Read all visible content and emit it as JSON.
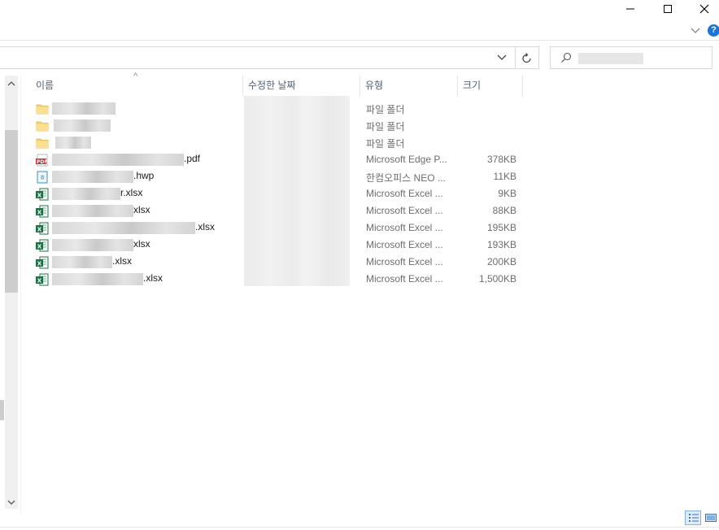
{
  "window": {
    "minimize_icon": "minimize-icon",
    "maximize_icon": "maximize-icon",
    "close_icon": "close-icon"
  },
  "ribbon": {
    "expand_icon": "chevron-down-icon",
    "help_icon": "help-icon",
    "help_label": "?"
  },
  "address": {
    "dropdown_icon": "chevron-down-icon",
    "refresh_icon": "refresh-icon"
  },
  "search": {
    "icon": "search-icon"
  },
  "columns": {
    "name": "이름",
    "date": "수정한 날짜",
    "type": "유형",
    "size": "크기",
    "sort_indicator": "^"
  },
  "files": [
    {
      "icon": "folder-icon",
      "ext": "",
      "type": "파일 폴더",
      "size": ""
    },
    {
      "icon": "folder-icon",
      "ext": "",
      "type": "파일 폴더",
      "size": ""
    },
    {
      "icon": "folder-icon",
      "ext": "",
      "type": "파일 폴더",
      "size": ""
    },
    {
      "icon": "pdf-icon",
      "ext": ".pdf",
      "type": "Microsoft Edge P...",
      "size": "378KB"
    },
    {
      "icon": "hwp-icon",
      "ext": ".hwp",
      "type": "한컴오피스 NEO ...",
      "size": "11KB"
    },
    {
      "icon": "excel-icon",
      "ext": "r.xlsx",
      "type": "Microsoft Excel ...",
      "size": "9KB"
    },
    {
      "icon": "excel-icon",
      "ext": "xlsx",
      "type": "Microsoft Excel ...",
      "size": "88KB"
    },
    {
      "icon": "excel-icon",
      "ext": ".xlsx",
      "type": "Microsoft Excel ...",
      "size": "195KB"
    },
    {
      "icon": "excel-icon",
      "ext": "xlsx",
      "type": "Microsoft Excel ...",
      "size": "193KB"
    },
    {
      "icon": "excel-icon",
      "ext": ".xlsx",
      "type": "Microsoft Excel ...",
      "size": "200KB"
    },
    {
      "icon": "excel-icon",
      "ext": ".xlsx",
      "type": "Microsoft Excel ...",
      "size": "1,500KB"
    }
  ],
  "view_buttons": {
    "details_icon": "details-view-icon",
    "large_icons_icon": "large-icons-view-icon"
  }
}
